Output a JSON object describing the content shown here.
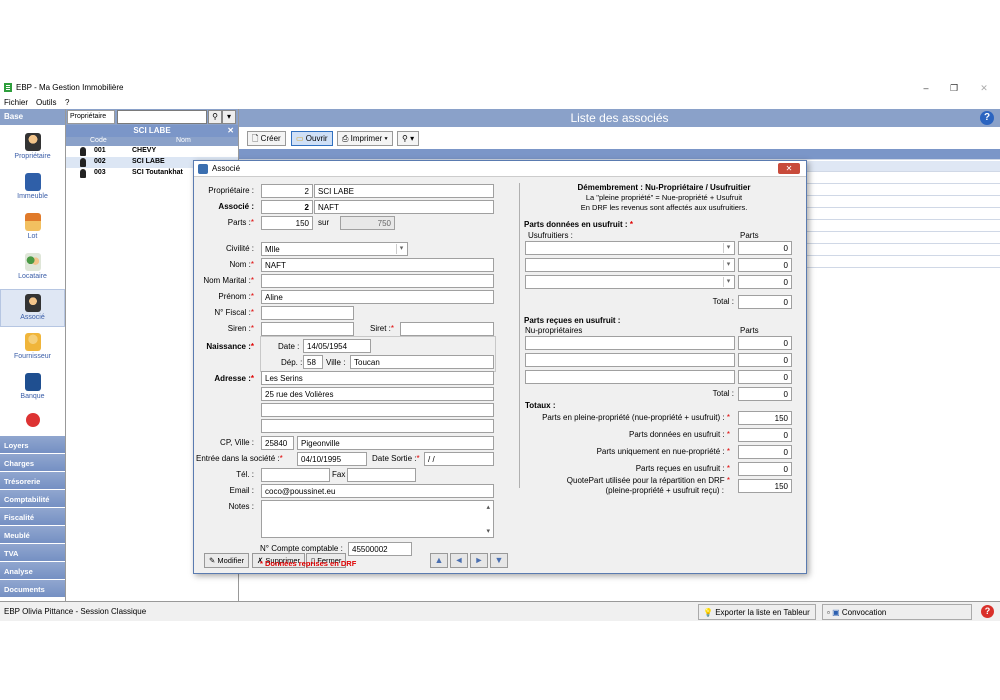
{
  "window": {
    "title": "EBP - Ma Gestion Immobilière"
  },
  "menu": [
    "Fichier",
    "Outils",
    "?"
  ],
  "nav": {
    "base_label": "Base",
    "items": [
      {
        "label": "Propriétaire",
        "icon": "owner-icon"
      },
      {
        "label": "Immeuble",
        "icon": "building-icon"
      },
      {
        "label": "Lot",
        "icon": "house-icon"
      },
      {
        "label": "Locataire",
        "icon": "tenants-icon"
      },
      {
        "label": "Associé",
        "icon": "partner-icon"
      },
      {
        "label": "Fournisseur",
        "icon": "supplier-icon"
      },
      {
        "label": "Banque",
        "icon": "bank-icon"
      }
    ],
    "sections": [
      "Loyers",
      "Charges",
      "Trésorerie",
      "Comptabilité",
      "Fiscalité",
      "Meublé",
      "TVA",
      "Analyse",
      "Documents"
    ]
  },
  "owner_panel": {
    "search_label": "Propriétaire",
    "title": "SCI LABE",
    "col_code": "Code",
    "col_nom": "Nom",
    "rows": [
      {
        "code": "001",
        "nom": "CHEVY"
      },
      {
        "code": "002",
        "nom": "SCI LABE"
      },
      {
        "code": "003",
        "nom": "SCI Toutankhat"
      }
    ]
  },
  "main": {
    "title": "Liste des associés",
    "toolbar": {
      "create": "Créer",
      "open": "Ouvrir",
      "print": "Imprimer"
    }
  },
  "status": {
    "session": "EBP Olivia Pittance - Session Classique",
    "export": "Exporter la liste en Tableur",
    "convocation": "Convocation"
  },
  "dialog": {
    "title": "Associé",
    "proprietaire_label": "Propriétaire :",
    "proprietaire_num": "2",
    "proprietaire_name": "SCI LABE",
    "associe_label": "Associé :",
    "associe_num": "2",
    "associe_name": "NAFT",
    "parts_label": "Parts :",
    "parts_value": "150",
    "sur_label": "sur",
    "sur_value": "750",
    "civilite_label": "Civilité :",
    "civilite_value": "Mlle",
    "nom_label": "Nom :",
    "nom_value": "NAFT",
    "nom_marital_label": "Nom Marital :",
    "prenom_label": "Prénom :",
    "prenom_value": "Aline",
    "fiscal_label": "N° Fiscal :",
    "siren_label": "Siren :",
    "siret_label": "Siret :",
    "naissance_label": "Naissance :",
    "date_label": "Date :",
    "date_value": "14/05/1954",
    "dep_label": "Dép. :",
    "dep_value": "58",
    "ville_label": "Ville :",
    "ville_value": "Toucan",
    "adresse_label": "Adresse :",
    "adresse1": "Les Serins",
    "adresse2": "25 rue des Volières",
    "cp_label": "CP, Ville :",
    "cp_value": "25840",
    "cp_ville": "Pigeonville",
    "entree_label": "Entrée dans la société :",
    "entree_value": "04/10/1995",
    "sortie_label": "Date Sortie :",
    "sortie_value": "/ /",
    "tel_label": "Tél. :",
    "fax_label": "Fax",
    "email_label": "Email :",
    "email_value": "coco@poussinet.eu",
    "notes_label": "Notes :",
    "compte_label": "N° Compte comptable :",
    "compte_value": "45500002",
    "drf_note": "* Données reprises en DRF",
    "btn_modifier": "Modifier",
    "btn_supprimer": "Supprimer",
    "btn_fermer": "Fermer",
    "right": {
      "title": "Démembrement : Nu-Propriétaire / Usufruitier",
      "line1": "La \"pleine propriété\" = Nue-propriété + Usufruit",
      "line2": "En DRF les revenus sont affectés aux usufruitiers.",
      "donnees_title": "Parts données en usufruit :",
      "usufruitiers_label": "Usufruitiers :",
      "parts_col": "Parts",
      "given": [
        "0",
        "0",
        "0"
      ],
      "total_label": "Total :",
      "given_total": "0",
      "recues_title": "Parts reçues en usufruit :",
      "nu_label": "Nu-propriétaires",
      "received": [
        "0",
        "0",
        "0"
      ],
      "received_total": "0",
      "totaux_title": "Totaux :",
      "t1_label": "Parts en pleine-propriété (nue-propriété + usufruit) :",
      "t1_value": "150",
      "t2_label": "Parts données en usufruit :",
      "t2_value": "0",
      "t3_label": "Parts uniquement en nue-propriété :",
      "t3_value": "0",
      "t4_label": "Parts reçues en usufruit :",
      "t4_value": "0",
      "t5_label1": "QuotePart utilisée pour la répartition en DRF",
      "t5_label2": "(pleine-propriété + usufruit reçu) :",
      "t5_value": "150"
    }
  }
}
